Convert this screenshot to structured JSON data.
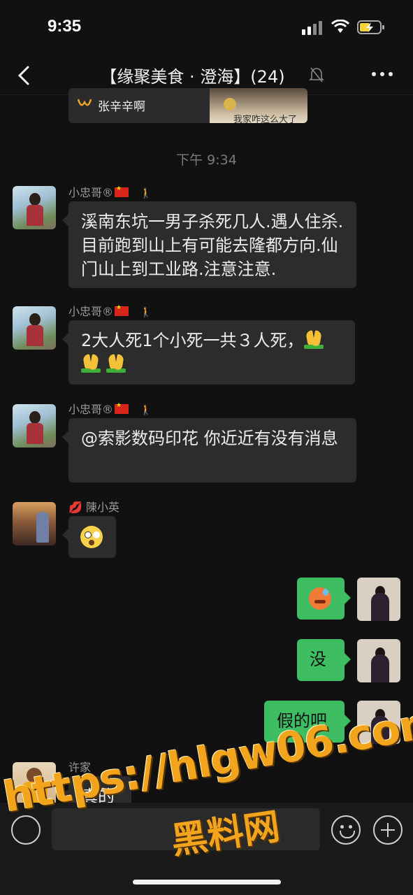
{
  "status_bar": {
    "time": "9:35"
  },
  "header": {
    "title": "【缘聚美食 · 澄海】(24)"
  },
  "preview": {
    "name": "张辛辛啊",
    "subtitle": "我家咋这么大了"
  },
  "timestamp": "下午 9:34",
  "messages": [
    {
      "sender": "小忠哥®",
      "text": "溪南东坑一男子杀死几人.遇人住杀.目前跑到山上有可能去隆都方向.仙门山上到工业路.注意注意."
    },
    {
      "sender": "小忠哥®",
      "text": "2大人死1个小死一共３人死，"
    },
    {
      "sender": "小忠哥®",
      "text": "@索影数码印花 你近近有没有消息"
    },
    {
      "sender": "陳小英",
      "emoji": "shocked-face"
    },
    {
      "sender": "me",
      "emoji": "sweat-face"
    },
    {
      "sender": "me",
      "text": "没"
    },
    {
      "sender": "me",
      "text": "假的吧"
    },
    {
      "sender": "许家",
      "text": "真的"
    }
  ],
  "watermark": {
    "url": "https://hlgw06.com",
    "name": "黑料网"
  },
  "colors": {
    "background": "#111111",
    "bubble_in": "#2c2c2c",
    "bubble_out": "#3fbd63",
    "watermark": "#f2a41c"
  }
}
